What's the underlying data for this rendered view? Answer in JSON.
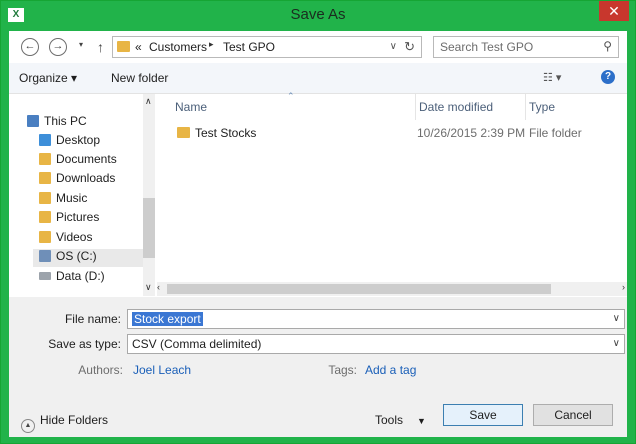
{
  "window": {
    "title": "Save As",
    "app_icon": "X",
    "close_icon": "close-icon"
  },
  "address": {
    "prefix": "«",
    "crumbs": [
      "Customers",
      "Test GPO"
    ]
  },
  "search": {
    "placeholder": "Search Test GPO"
  },
  "toolbar": {
    "organize": "Organize ▾",
    "new_folder": "New folder"
  },
  "nav": {
    "items": [
      "This PC",
      "Desktop",
      "Documents",
      "Downloads",
      "Music",
      "Pictures",
      "Videos",
      "OS (C:)",
      "Data (D:)"
    ]
  },
  "filelist": {
    "columns": [
      "Name",
      "Date modified",
      "Type"
    ],
    "rows": [
      {
        "name": "Test Stocks",
        "date": "10/26/2015 2:39 PM",
        "type": "File folder"
      }
    ]
  },
  "form": {
    "file_name_label": "File name:",
    "file_name_value": "Stock export",
    "save_type_label": "Save as type:",
    "save_type_value": "CSV (Comma delimited)",
    "authors_label": "Authors:",
    "authors_value": "Joel Leach",
    "tags_label": "Tags:",
    "tags_value": "Add a tag"
  },
  "footer": {
    "hide_folders": "Hide Folders",
    "tools": "Tools",
    "save": "Save",
    "cancel": "Cancel"
  },
  "colors": {
    "frame": "#21b34a",
    "close": "#c8372d",
    "link": "#1a5fb8"
  }
}
